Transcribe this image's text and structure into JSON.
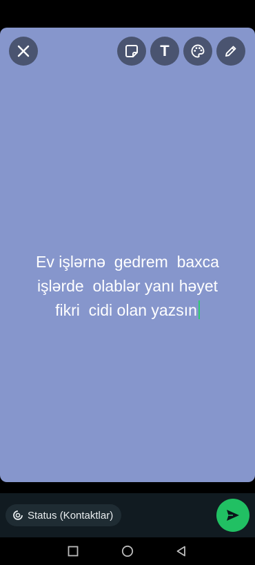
{
  "canvas": {
    "background_color": "#8696cc",
    "text": "Ev işlərnə  gedrem  baxca\nişlərde  olablər yanı həyet\nfikri  cidi olan yazsın",
    "text_color": "#ffffff",
    "cursor_color": "#2ecc71"
  },
  "toolbar": {
    "close_icon": "close-icon",
    "sticker_icon": "sticker-icon",
    "text_icon": "text-icon",
    "text_icon_glyph": "T",
    "palette_icon": "palette-icon",
    "pencil_icon": "pencil-icon"
  },
  "footer": {
    "audience_icon": "status-privacy-icon",
    "audience_label": "Status (Kontaktlar)",
    "send_icon": "send-icon",
    "send_color": "#21c063"
  },
  "nav": {
    "recents_icon": "square-icon",
    "home_icon": "circle-icon",
    "back_icon": "triangle-back-icon"
  }
}
